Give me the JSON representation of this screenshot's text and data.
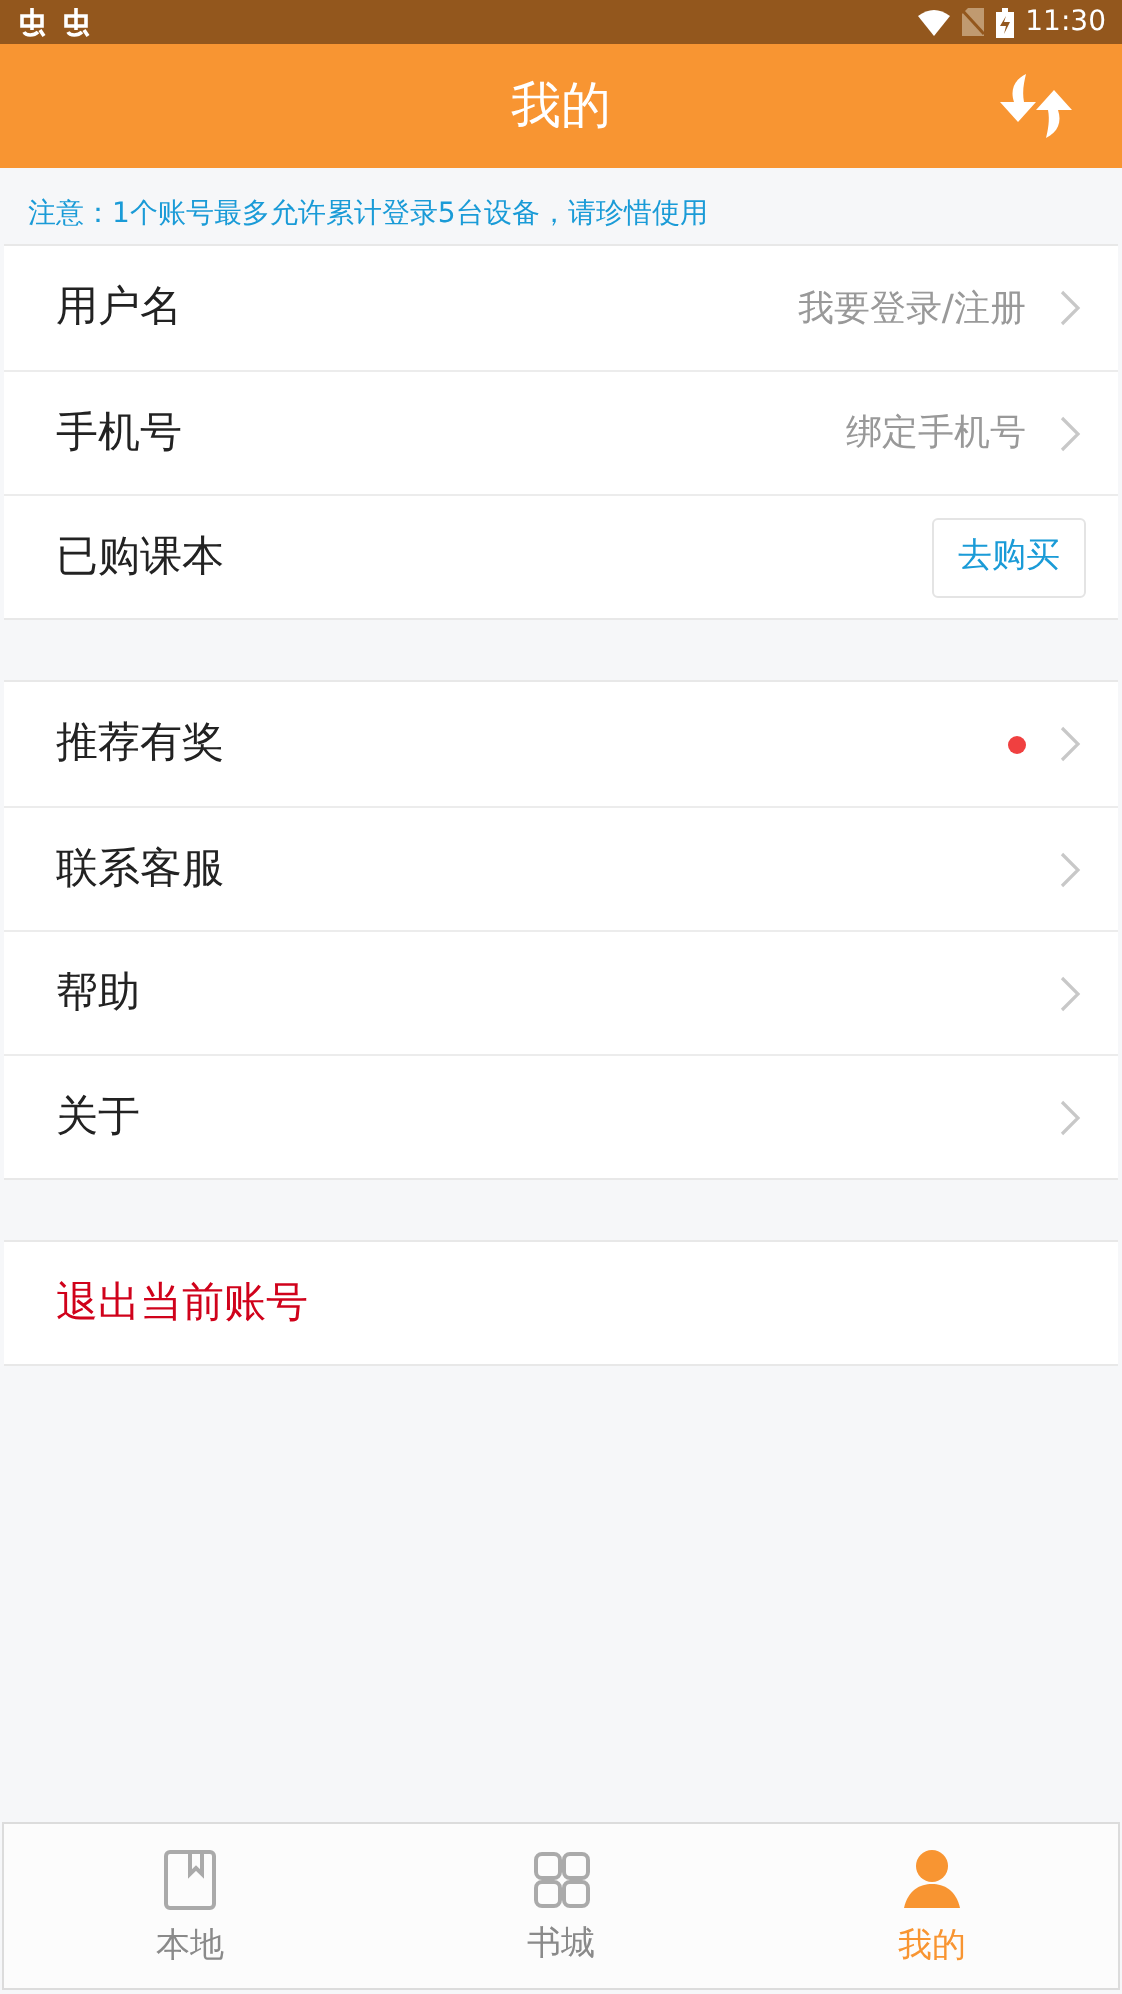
{
  "status_bar": {
    "time": "11:30"
  },
  "header": {
    "title": "我的"
  },
  "notice": "注意：1个账号最多允许累计登录5台设备，请珍惜使用",
  "groups": [
    {
      "rows": [
        {
          "kind": "link",
          "label": "用户名",
          "value": "我要登录/注册"
        },
        {
          "kind": "link",
          "label": "手机号",
          "value": "绑定手机号"
        },
        {
          "kind": "action",
          "label": "已购课本",
          "button": "去购买"
        }
      ]
    },
    {
      "rows": [
        {
          "kind": "link",
          "label": "推荐有奖",
          "badge": true
        },
        {
          "kind": "link",
          "label": "联系客服",
          "badge": false
        },
        {
          "kind": "link",
          "label": "帮助",
          "badge": false
        },
        {
          "kind": "link",
          "label": "关于",
          "badge": false
        }
      ]
    }
  ],
  "logout": "退出当前账号",
  "tabs": [
    {
      "kind": "local",
      "label": "本地",
      "selected": false
    },
    {
      "kind": "store",
      "label": "书城",
      "selected": false
    },
    {
      "kind": "me",
      "label": "我的",
      "selected": true
    }
  ]
}
